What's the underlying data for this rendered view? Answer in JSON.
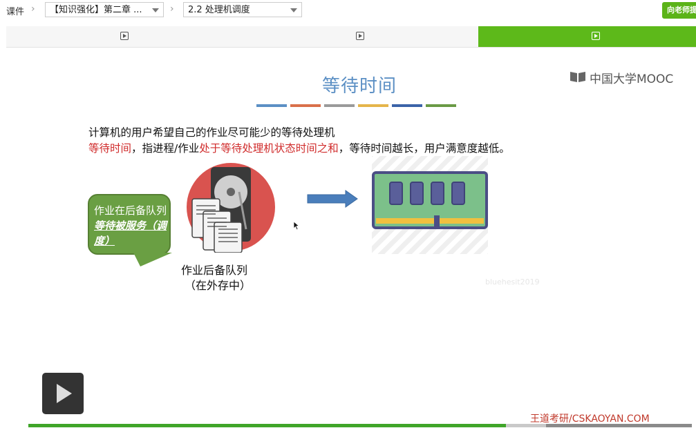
{
  "breadcrumb": {
    "root": "课件",
    "chapter_select": "【知识强化】第二章 ...",
    "lesson_select": "2.2 处理机调度",
    "ask_teacher_button": "向老师提问"
  },
  "unit_tabs": [
    {
      "icon": "video-icon",
      "active": false
    },
    {
      "icon": "video-icon",
      "active": false
    },
    {
      "icon": "video-icon",
      "active": true
    }
  ],
  "slide": {
    "title": "等待时间",
    "title_bar_colors": [
      "#5b8fc4",
      "#d9704a",
      "#9a9a9a",
      "#e5b54a",
      "#3b63a8",
      "#6a9a45"
    ],
    "logo_text": "中国大学MOOC",
    "line1": "计算机的用户希望自己的作业尽可能少的等待处理机",
    "line2_part1": "等待时间",
    "line2_part2": "，指进程/作业",
    "line2_part3": "处于等待处理机状态时间之和",
    "line2_part4": "，等待时间越长，用户满意度越低。",
    "bubble_plain": "作业在后备队列",
    "bubble_emph": "等待被服务（调度）",
    "queue_label": "作业后备队列",
    "queue_sub": "（在外存中）",
    "watermark": "bluehesit2019",
    "footer_brand": "王道考研/CSKAOYAN.COM"
  },
  "player": {
    "state": "paused",
    "progress_fraction": 0.72,
    "buffered_fraction": 0.78
  },
  "colors": {
    "accent_green": "#5db91a",
    "title_blue": "#5b8fc4",
    "highlight_red": "#d02c2c"
  }
}
